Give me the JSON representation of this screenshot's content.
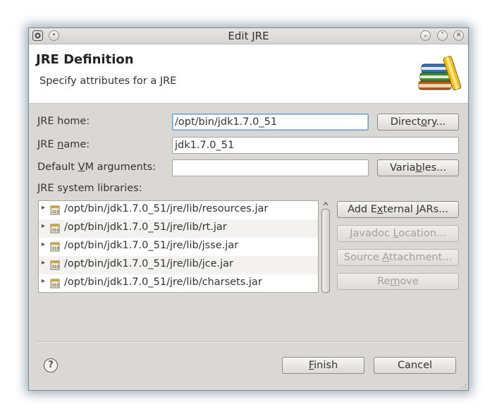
{
  "window": {
    "title": "Edit JRE"
  },
  "header": {
    "title": "JRE Definition",
    "subtitle": "Specify attributes for a JRE",
    "icon": "books-icon"
  },
  "form": {
    "jre_home": {
      "label_pre": "",
      "label_key": "J",
      "label_post": "RE home:",
      "value": "/opt/bin/jdk1.7.0_51"
    },
    "jre_name": {
      "label_pre": "JRE ",
      "label_key": "n",
      "label_post": "ame:",
      "value": "jdk1.7.0_51"
    },
    "vm_args": {
      "label_pre": "Default ",
      "label_key": "V",
      "label_post": "M arguments:",
      "value": ""
    },
    "directory_button": {
      "pre": "Direct",
      "key": "o",
      "post": "ry..."
    },
    "variables_button": {
      "pre": "Varia",
      "key": "b",
      "post": "les..."
    }
  },
  "libraries": {
    "label": "JRE system libraries:",
    "items": [
      "/opt/bin/jdk1.7.0_51/jre/lib/resources.jar",
      "/opt/bin/jdk1.7.0_51/jre/lib/rt.jar",
      "/opt/bin/jdk1.7.0_51/jre/lib/jsse.jar",
      "/opt/bin/jdk1.7.0_51/jre/lib/jce.jar",
      "/opt/bin/jdk1.7.0_51/jre/lib/charsets.jar"
    ],
    "buttons": {
      "add_external": {
        "pre": "Add E",
        "key": "x",
        "post": "ternal JARs..."
      },
      "javadoc": {
        "pre": "Javadoc ",
        "key": "L",
        "post": "ocation..."
      },
      "source": {
        "pre": "Source ",
        "key": "A",
        "post": "ttachment..."
      },
      "remove": {
        "pre": "Re",
        "key": "m",
        "post": "ove"
      }
    }
  },
  "footer": {
    "help": "?",
    "finish": {
      "pre": "",
      "key": "F",
      "post": "inish"
    },
    "cancel": "Cancel"
  }
}
